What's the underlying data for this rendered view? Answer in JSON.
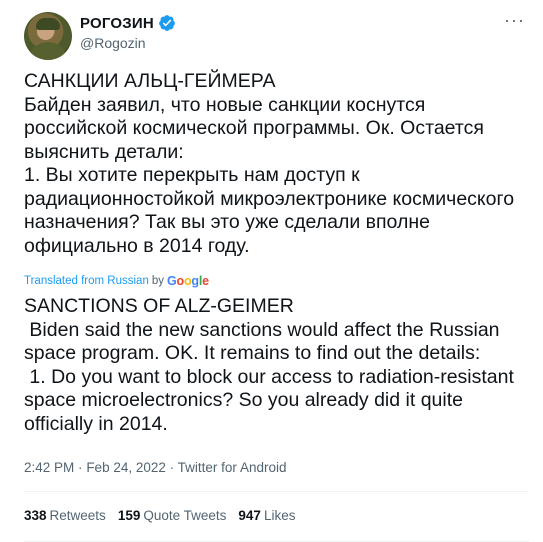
{
  "user": {
    "display_name": "РОГОЗИН",
    "handle": "@Rogozin",
    "verified": true
  },
  "menu_icon": "more-horizontal-icon",
  "tweet": {
    "text": "САНКЦИИ АЛЬЦ-ГЕЙМЕРА\nБайден заявил, что новые санкции коснутся российской космической программы. Ок. Остается выяснить детали:\n1. Вы хотите перекрыть нам доступ к радиационностойкой микроэлектронике космического назначения? Так вы это уже сделали вполне официально в 2014 году."
  },
  "translation": {
    "label": "Translated from Russian",
    "by": "by",
    "provider": "Google",
    "text": "SANCTIONS OF ALZ-GEIMER\n Biden said the new sanctions would affect the Russian space program. OK. It remains to find out the details:\n 1. Do you want to block our access to radiation-resistant space microelectronics? So you already did it quite officially in 2014."
  },
  "meta": {
    "time": "2:42 PM",
    "date": "Feb 24, 2022",
    "separator": "·",
    "source": "Twitter for Android"
  },
  "stats": {
    "retweets": {
      "count": "338",
      "label": "Retweets"
    },
    "quote_tweets": {
      "count": "159",
      "label": "Quote Tweets"
    },
    "likes": {
      "count": "947",
      "label": "Likes"
    }
  },
  "colors": {
    "link_blue": "#1d9bf0",
    "secondary_text": "#536471",
    "primary_text": "#0f1419"
  }
}
